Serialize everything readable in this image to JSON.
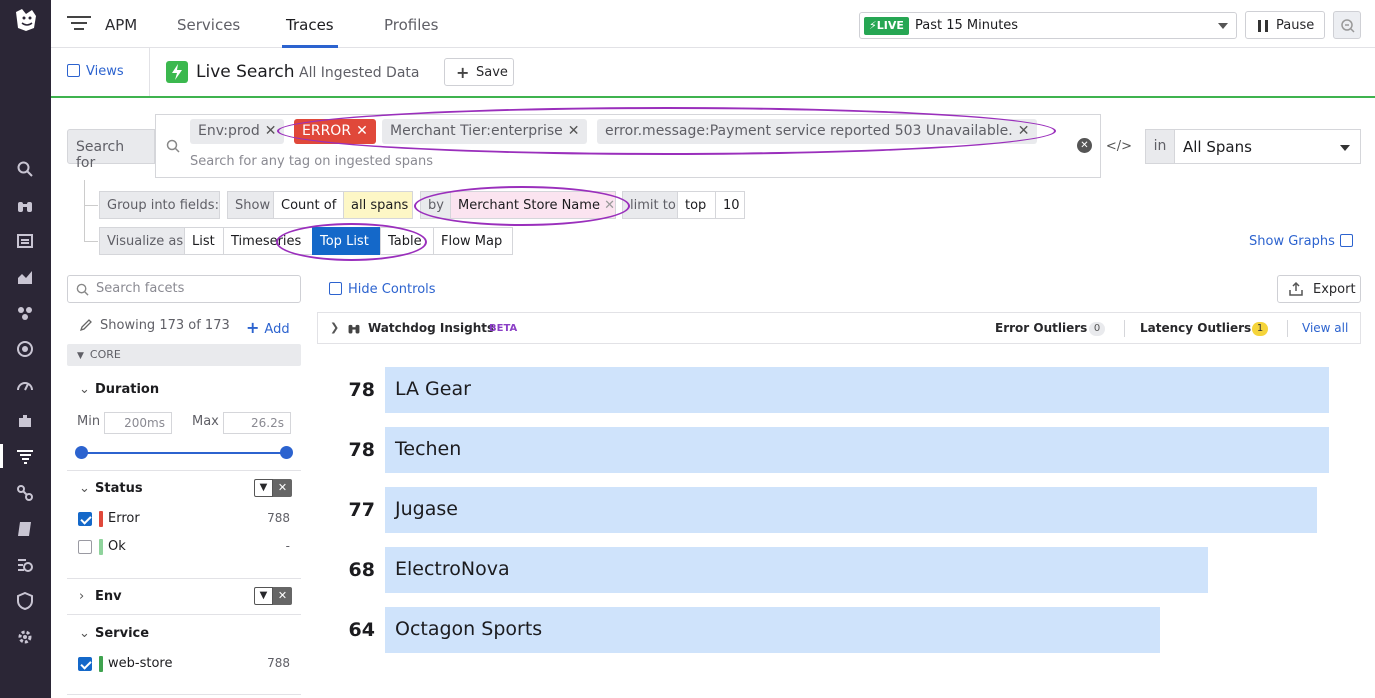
{
  "topbar": {
    "product": "APM",
    "tabs": [
      {
        "label": "Services"
      },
      {
        "label": "Traces"
      },
      {
        "label": "Profiles"
      }
    ],
    "live_badge": "LIVE",
    "time_range": "Past 15 Minutes",
    "pause_label": "Pause"
  },
  "viewsbar": {
    "views_label": "Views",
    "title": "Live Search",
    "subtitle": "All Ingested Data",
    "save_label": "Save"
  },
  "search": {
    "search_for_label": "Search for",
    "chips": [
      "Env:prod",
      "ERROR",
      "Merchant Tier:enterprise",
      "error.message:Payment service reported 503 Unavailable."
    ],
    "hint": "Search for any tag on ingested spans",
    "in_label": "in",
    "scope": "All Spans"
  },
  "group": {
    "group_label": "Group into fields:",
    "show_label": "Show",
    "count_of": "Count of",
    "all_spans": "all spans",
    "by_label": "by",
    "by_field": "Merchant Store Name",
    "limit_label": "limit to",
    "limit_mode": "top",
    "limit_value": "10"
  },
  "visualize": {
    "label": "Visualize as",
    "options": [
      "List",
      "Timeseries",
      "Top List",
      "Table",
      "Flow Map"
    ],
    "selected": "Top List",
    "show_graphs": "Show Graphs"
  },
  "facets": {
    "search_placeholder": "Search facets",
    "showing": "Showing 173 of 173",
    "add_label": "Add",
    "core_label": "CORE",
    "duration": {
      "title": "Duration",
      "min_label": "Min",
      "min_value": "200ms",
      "max_label": "Max",
      "max_value": "26.2s"
    },
    "status": {
      "title": "Status",
      "items": [
        {
          "name": "Error",
          "count": "788",
          "checked": true,
          "color": "#e0483a"
        },
        {
          "name": "Ok",
          "count": "-",
          "checked": false,
          "color": "#8fd39c"
        }
      ]
    },
    "env": {
      "title": "Env"
    },
    "service": {
      "title": "Service",
      "items": [
        {
          "name": "web-store",
          "count": "788",
          "checked": true,
          "color": "#3fa34f"
        }
      ]
    }
  },
  "main": {
    "hide_controls": "Hide Controls",
    "export_label": "Export",
    "watchdog": {
      "title": "Watchdog Insights",
      "beta": "BETA",
      "error_outliers_label": "Error Outliers",
      "error_outliers_count": "0",
      "latency_outliers_label": "Latency Outliers",
      "latency_outliers_count": "1",
      "view_all": "View all"
    },
    "toplist": [
      {
        "count": "78",
        "name": "LA Gear",
        "value": 78
      },
      {
        "count": "78",
        "name": "Techen",
        "value": 78
      },
      {
        "count": "77",
        "name": "Jugase",
        "value": 77
      },
      {
        "count": "68",
        "name": "ElectroNova",
        "value": 68
      },
      {
        "count": "64",
        "name": "Octagon Sports",
        "value": 64
      }
    ]
  },
  "colors": {
    "accent": "#2c63cf",
    "live_green": "#26a653",
    "error_red": "#e0483a",
    "bar_fill": "#cfe3fb",
    "annotation_purple": "#9a2fbc",
    "nav_bg": "#2b2636"
  }
}
